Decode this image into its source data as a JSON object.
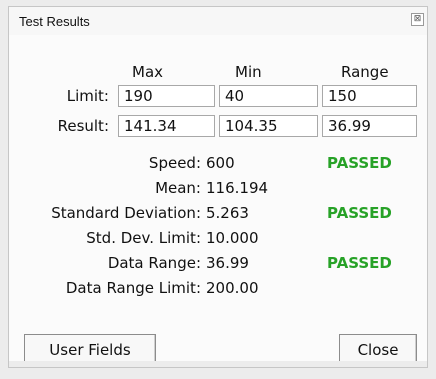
{
  "window": {
    "title": "Test Results",
    "close_glyph": "⊠"
  },
  "table": {
    "columns": [
      "Max",
      "Min",
      "Range"
    ],
    "rows": [
      {
        "label": "Limit:",
        "values": [
          "190",
          "40",
          "150"
        ]
      },
      {
        "label": "Result:",
        "values": [
          "141.34",
          "104.35",
          "36.99"
        ]
      }
    ]
  },
  "stats": [
    {
      "label": "Speed:",
      "value": "600",
      "status": "PASSED"
    },
    {
      "label": "Mean:",
      "value": "116.194",
      "status": ""
    },
    {
      "label": "Standard Deviation:",
      "value": "5.263",
      "status": "PASSED"
    },
    {
      "label": "Std. Dev. Limit:",
      "value": "10.000",
      "status": ""
    },
    {
      "label": "Data Range:",
      "value": "36.99",
      "status": "PASSED"
    },
    {
      "label": "Data Range Limit:",
      "value": "200.00",
      "status": ""
    }
  ],
  "buttons": {
    "user_fields": "User Fields",
    "close": "Close"
  },
  "colors": {
    "passed": "#27a227"
  }
}
